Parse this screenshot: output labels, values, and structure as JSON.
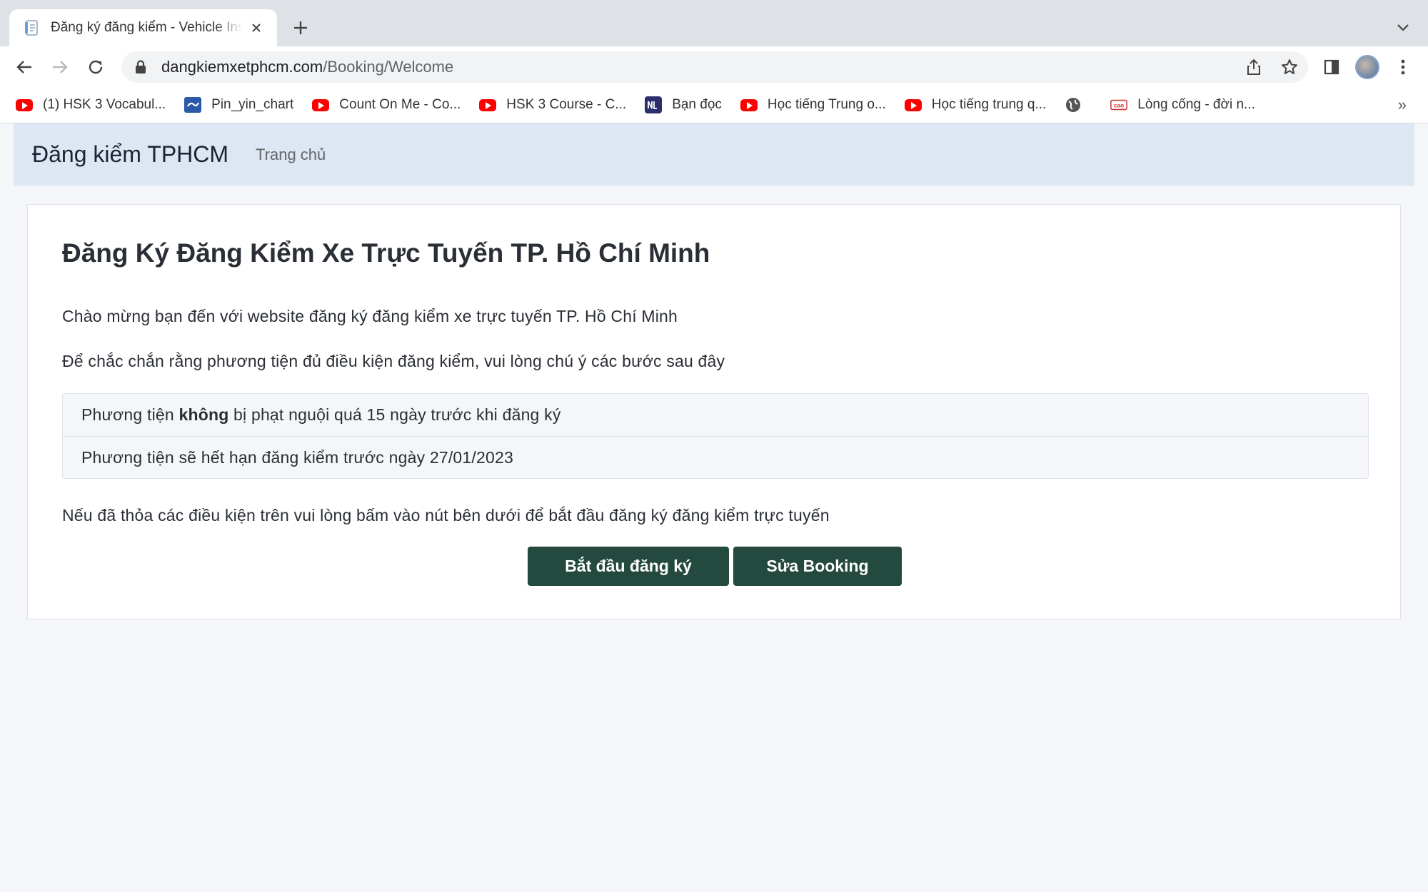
{
  "browser": {
    "tab": {
      "title": "Đăng ký đăng kiểm - Vehicle Inspection"
    },
    "url": {
      "host": "dangkiemxetphcm.com",
      "path": "/Booking/Welcome"
    },
    "bookmarks": [
      {
        "label": "(1) HSK 3 Vocabul...",
        "icon": "youtube-icon"
      },
      {
        "label": "Pin_yin_chart",
        "icon": "chart-icon"
      },
      {
        "label": "Count On Me - Co...",
        "icon": "youtube-icon"
      },
      {
        "label": "HSK 3 Course - C...",
        "icon": "youtube-icon"
      },
      {
        "label": "Bạn đọc",
        "icon": "nld-icon"
      },
      {
        "label": "Học tiếng Trung o...",
        "icon": "youtube-icon"
      },
      {
        "label": "Học tiếng trung q...",
        "icon": "youtube-icon"
      },
      {
        "label": "",
        "icon": "globe-icon"
      },
      {
        "label": "Lòng cống - đời n...",
        "icon": "cao-icon"
      }
    ],
    "colors": {
      "tabstrip": "#dee1e6",
      "youtube": "#ff0000"
    }
  },
  "site": {
    "brand": "Đăng kiểm TPHCM",
    "nav_home": "Trang chủ",
    "title": "Đăng Ký Đăng Kiểm Xe Trực Tuyến TP. Hồ Chí Minh",
    "welcome": "Chào mừng bạn đến với website đăng ký đăng kiểm xe trực tuyến TP. Hồ Chí Minh",
    "instructions": "Để chắc chắn rằng phương tiện đủ điều kiện đăng kiểm, vui lòng chú ý các bước sau đây",
    "conditions": [
      {
        "before": "Phương tiện ",
        "bold": "không",
        "after": " bị phạt nguội quá 15 ngày trước khi đăng ký"
      },
      {
        "text": "Phương tiện sẽ hết hạn đăng kiểm trước ngày 27/01/2023"
      }
    ],
    "proceed_note": "Nếu đã thỏa các điều kiện trên vui lòng bấm vào nút bên dưới để bắt đầu đăng ký đăng kiểm trực tuyến",
    "start_button": "Bắt đầu đăng ký",
    "edit_button": "Sửa Booking",
    "colors": {
      "primary_button": "#24493f",
      "navbar": "#dde6f3"
    }
  }
}
